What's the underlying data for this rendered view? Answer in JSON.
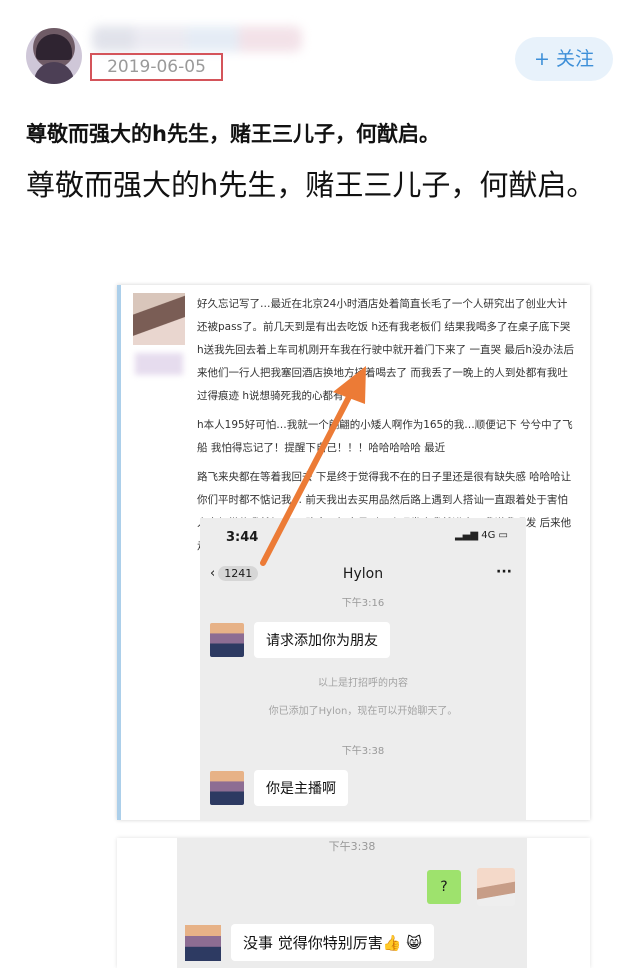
{
  "header": {
    "date": "2019-06-05",
    "follow_label": "+ 关注",
    "accent": "#3d8fd8",
    "date_box_color": "#d4545a"
  },
  "post": {
    "text_bold": "尊敬而强大的h先生，赌王三儿子，何猷启。",
    "text_large": "尊敬而强大的h先生，赌王三儿子，何猷启。"
  },
  "screenshot1": {
    "paragraphs": [
      "好久忘记写了…最近在北京24小时酒店处着简直长毛了一个人研究出了创业大计还被pass了。前几天到是有出去吃饭 h还有我老板们 结果我喝多了在桌子底下哭 h送我先回去着上车司机刚开车我在行驶中就开着门下来了 一直哭 最后h没办法后来他们一行人把我塞回酒店换地方接着喝去了 而我丢了一晚上的人到处都有我吐过得痕迹 h说想骑死我的心都有",
      "h本人195好可怕…我就一个翩翩的小矮人啊作为165的我…顺便记下 兮兮中了飞船 我怕得忘记了！提醒下自己！！！哈哈哈哈哈 最近",
      "路飞来央都在等着我回去 下是终于觉得我不在的日子里还是很有缺失感 哈哈哈让你们平时都不惦记我… 前天我出去买用品然后路上遇到人搭讪一直跟着处于害怕人家加微信我就加了 一路走了好多见到一个理发店我就进去了我说我理发 后来他走了…唔魅力的烦恼"
    ],
    "chat": {
      "time": "3:44",
      "signal": "4G",
      "back_count": "1241",
      "title": "Hylon",
      "more": "···",
      "timestamp1": "下午3:16",
      "message1": "请求添加你为朋友",
      "system1": "以上是打招呼的内容",
      "system2": "你已添加了Hylon，现在可以开始聊天了。",
      "timestamp2": "下午3:38",
      "message2": "你是主播啊"
    }
  },
  "screenshot2": {
    "timestamp": "下午3:38",
    "sent": "?",
    "received": "没事 觉得你特别厉害👍 😸"
  }
}
